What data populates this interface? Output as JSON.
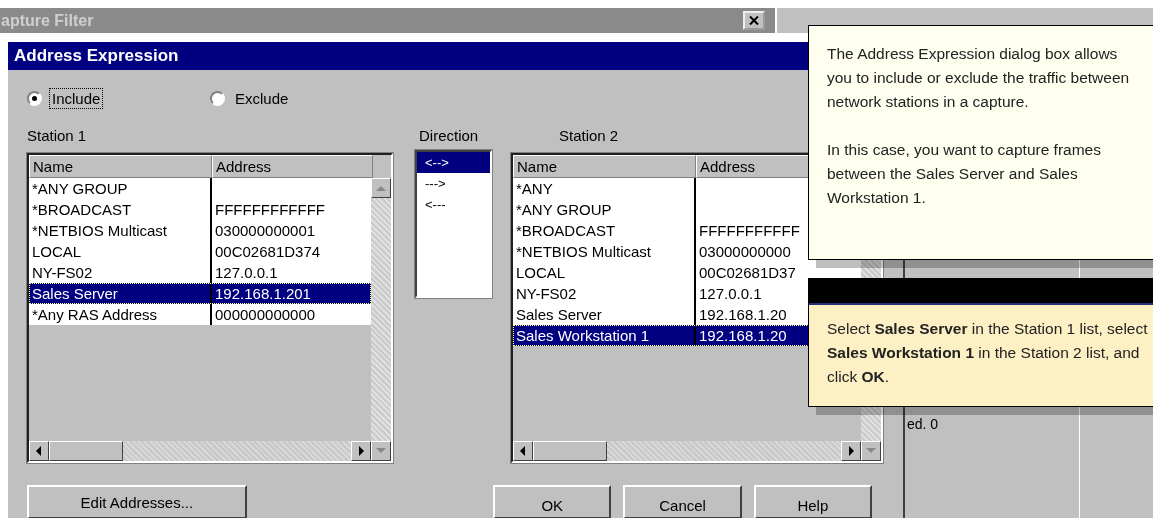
{
  "capture_window": {
    "title": "apture Filter"
  },
  "dialog": {
    "title": "Address Expression",
    "filter_mode": [
      {
        "label": "Include",
        "selected": true
      },
      {
        "label": "Exclude",
        "selected": false
      }
    ],
    "stations": [
      {
        "label": "Station 1",
        "columns": [
          "Name",
          "Address"
        ],
        "rows": [
          {
            "name": "*ANY GROUP",
            "address": "",
            "selected": false
          },
          {
            "name": "*BROADCAST",
            "address": "FFFFFFFFFFFF",
            "selected": false
          },
          {
            "name": "*NETBIOS Multicast",
            "address": "030000000001",
            "selected": false
          },
          {
            "name": "LOCAL",
            "address": "00C02681D374",
            "selected": false
          },
          {
            "name": "NY-FS02",
            "address": "127.0.0.1",
            "selected": false
          },
          {
            "name": "Sales Server",
            "address": "192.168.1.201",
            "selected": true
          },
          {
            "name": "*Any RAS Address",
            "address": "000000000000",
            "selected": false
          }
        ]
      },
      {
        "label": "Station 2",
        "columns": [
          "Name",
          "Address"
        ],
        "rows": [
          {
            "name": "*ANY",
            "address": "",
            "selected": false
          },
          {
            "name": "*ANY GROUP",
            "address": "",
            "selected": false
          },
          {
            "name": "*BROADCAST",
            "address": "FFFFFFFFFFF",
            "selected": false
          },
          {
            "name": "*NETBIOS Multicast",
            "address": "03000000000",
            "selected": false
          },
          {
            "name": "LOCAL",
            "address": "00C02681D37",
            "selected": false
          },
          {
            "name": "NY-FS02",
            "address": "127.0.0.1",
            "selected": false
          },
          {
            "name": "Sales Server",
            "address": "192.168.1.20",
            "selected": false
          },
          {
            "name": "Sales Workstation 1",
            "address": "192.168.1.20",
            "selected": true
          }
        ]
      }
    ],
    "direction": {
      "label": "Direction",
      "options": [
        {
          "label": "<-->",
          "selected": true
        },
        {
          "label": "--->",
          "selected": false
        },
        {
          "label": "<---",
          "selected": false
        }
      ]
    },
    "edit_button": "Edit Addresses...",
    "buttons": [
      "OK",
      "Cancel",
      "Help"
    ]
  },
  "background_window": {
    "text": "ed. 0"
  },
  "callouts": [
    {
      "kind": "note",
      "paragraphs": [
        "The Address Expression dialog box allows you to include or exclude the traffic between network stations in a capture.",
        "In this case, you want to capture frames between the Sales Server and Sales Workstation 1."
      ]
    },
    {
      "kind": "step",
      "paragraphs": [
        "Select **Sales Server** in the Station 1 list, select **Sales Workstation 1** in the Station 2 list, and click **OK**."
      ]
    }
  ]
}
